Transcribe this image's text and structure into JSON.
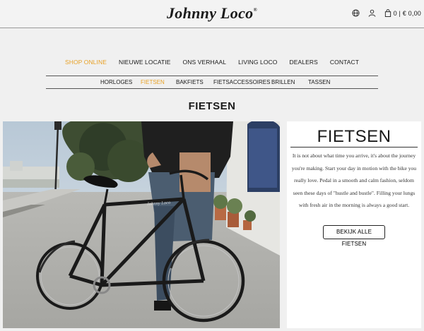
{
  "brand": {
    "logo_text": "Johnny Loco",
    "logo_mark": "®"
  },
  "header_icons": {
    "globe_icon": "globe-icon",
    "account_icon": "user-icon",
    "cart_icon": "shopping-bag-icon",
    "cart_label": "0 | € 0,00"
  },
  "main_nav": {
    "items": [
      {
        "label": "SHOP ONLINE",
        "active": true
      },
      {
        "label": "NIEUWE LOCATIE",
        "active": false
      },
      {
        "label": "ONS VERHAAL",
        "active": false
      },
      {
        "label": "LIVING LOCO",
        "active": false
      },
      {
        "label": "DEALERS",
        "active": false
      },
      {
        "label": "CONTACT",
        "active": false
      }
    ]
  },
  "sub_nav": {
    "items": [
      {
        "label": "HORLOGES",
        "active": false
      },
      {
        "label": "FIETSEN",
        "active": true
      },
      {
        "label": "BAKFIETS",
        "active": false
      },
      {
        "label": "FIETSACCESSOIRES",
        "active": false
      },
      {
        "label": "BRILLEN",
        "active": false
      },
      {
        "label": "TASSEN",
        "active": false
      }
    ]
  },
  "page": {
    "title": "FIETSEN"
  },
  "hero": {
    "frame_text": "Johnny Loco"
  },
  "panel": {
    "title": "FIETSEN",
    "description": "It is not about what time you arrive, it's about the journey you're making. Start your day in motion with the bike you really love. Pedal in a smooth and calm fashion, seldom seen these days of \"hustle and bustle\". Filling your lungs with fresh air in the morning is always a good start.",
    "button_label": "BEKIJK ALLE FIETSEN"
  },
  "colors": {
    "accent": "#e8a126",
    "background": "#f0f0f0",
    "panel_background": "#ffffff",
    "text": "#1a1a1a"
  }
}
